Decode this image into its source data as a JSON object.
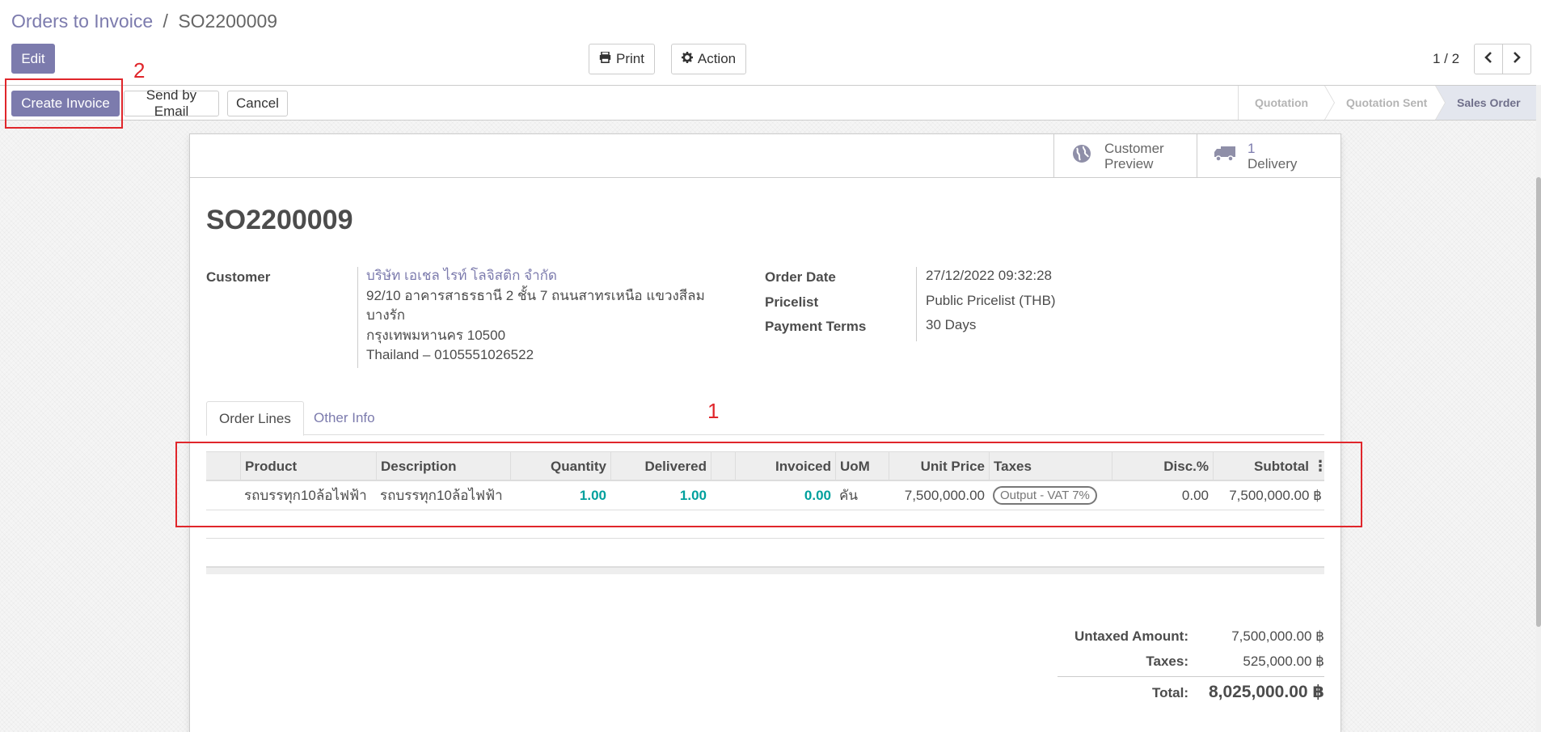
{
  "breadcrumb": {
    "parent": "Orders to Invoice",
    "separator": "/",
    "current": "SO2200009"
  },
  "toolbar": {
    "edit": "Edit",
    "print": "Print",
    "action": "Action",
    "pager": "1 / 2"
  },
  "statusbar": {
    "create_invoice": "Create Invoice",
    "send_by_email": "Send by Email",
    "cancel": "Cancel",
    "stages": [
      "Quotation",
      "Quotation Sent",
      "Sales Order"
    ],
    "active_stage": "Sales Order"
  },
  "smart_buttons": {
    "preview": {
      "line1": "Customer",
      "line2": "Preview",
      "icon": "globe-icon"
    },
    "delivery": {
      "count": "1",
      "label": "Delivery",
      "icon": "truck-icon"
    }
  },
  "record": {
    "name": "SO2200009",
    "customer_label": "Customer",
    "customer_name": "บริษัท เอเชล ไรท์ โลจิสติก จำกัด",
    "address_line1": "92/10 อาคารสาธรธานี 2 ชั้น 7 ถนนสาทรเหนือ แขวงสีลม",
    "address_line2": "บางรัก",
    "address_line3": "กรุงเทพมหานคร 10500",
    "address_line4": "Thailand – 0105551026522",
    "order_date_label": "Order Date",
    "order_date": "27/12/2022 09:32:28",
    "pricelist_label": "Pricelist",
    "pricelist": "Public Pricelist (THB)",
    "payment_terms_label": "Payment Terms",
    "payment_terms": "30 Days"
  },
  "tabs": {
    "order_lines": "Order Lines",
    "other_info": "Other Info"
  },
  "table": {
    "headers": {
      "product": "Product",
      "description": "Description",
      "quantity": "Quantity",
      "delivered": "Delivered",
      "invoiced": "Invoiced",
      "uom": "UoM",
      "unit_price": "Unit Price",
      "taxes": "Taxes",
      "disc": "Disc.%",
      "subtotal": "Subtotal"
    },
    "rows": [
      {
        "product": "รถบรรทุก10ล้อไฟฟ้า",
        "description": "รถบรรทุก10ล้อไฟฟ้า",
        "quantity": "1.00",
        "delivered": "1.00",
        "invoiced": "0.00",
        "uom": "คัน",
        "unit_price": "7,500,000.00",
        "taxes": "Output - VAT 7%",
        "disc": "0.00",
        "subtotal": "7,500,000.00 ฿"
      }
    ]
  },
  "totals": {
    "untaxed_label": "Untaxed Amount:",
    "untaxed": "7,500,000.00 ฿",
    "taxes_label": "Taxes:",
    "taxes": "525,000.00 ฿",
    "total_label": "Total:",
    "total": "8,025,000.00 ฿"
  },
  "annotations": {
    "one": "1",
    "two": "2"
  },
  "colors": {
    "primary": "#7c7bad",
    "accent_number": "#00a09d",
    "annotation": "#e0262b"
  }
}
